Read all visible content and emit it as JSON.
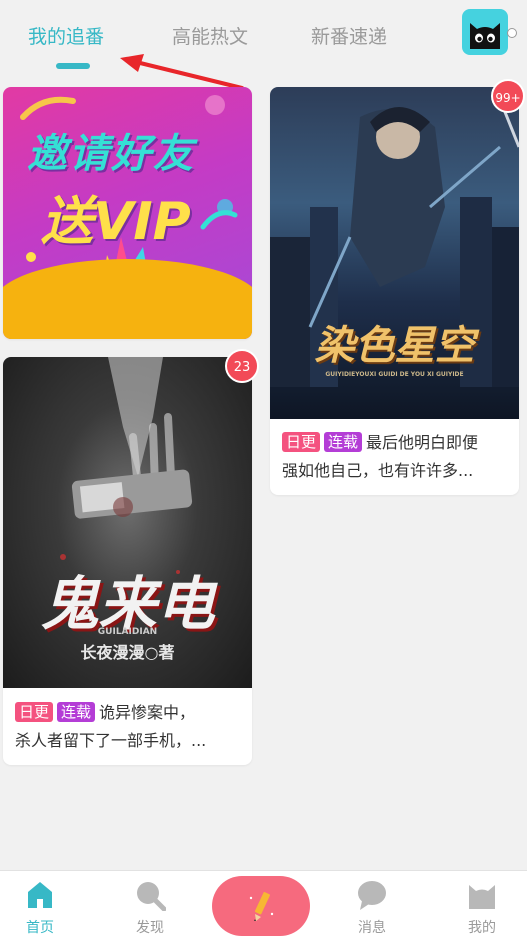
{
  "tabs": [
    {
      "label": "我的追番",
      "active": true
    },
    {
      "label": "高能热文",
      "active": false
    },
    {
      "label": "新番速递",
      "active": false
    }
  ],
  "colors": {
    "accent": "#37b8c6",
    "tag_daily": "#f4527f",
    "tag_serial": "#b43dd6",
    "badge": "#f24a57",
    "write_button": "#f66a7e",
    "annotation_arrow": "#e8262a"
  },
  "promo": {
    "line1": "邀请好友",
    "line2": "送VIP"
  },
  "books": [
    {
      "cover_title": "鬼来电",
      "cover_subtitle": "GUILAIDIAN",
      "cover_author": "长夜漫漫○著",
      "badge": "23",
      "tag_daily": "日更",
      "tag_serial": "连载",
      "line1": "诡异惨案中，",
      "line2": "杀人者留下了一部手机，..."
    },
    {
      "cover_title": "染色星空",
      "cover_subtitle": "GUIYIDIEYOUXI GUIDI DE YOU XI GUIYIDE",
      "badge": "99+",
      "tag_daily": "日更",
      "tag_serial": "连载",
      "line1": "最后他明白即便",
      "line2": "强如他自己，也有许许多..."
    }
  ],
  "bottom_nav": [
    {
      "label": "首页",
      "icon": "home-icon",
      "active": true
    },
    {
      "label": "发现",
      "icon": "search-icon",
      "active": false
    },
    {
      "label": "",
      "icon": "pencil-icon",
      "active": false
    },
    {
      "label": "消息",
      "icon": "chat-bubble-icon",
      "active": false
    },
    {
      "label": "我的",
      "icon": "cat-face-icon",
      "active": false
    }
  ]
}
